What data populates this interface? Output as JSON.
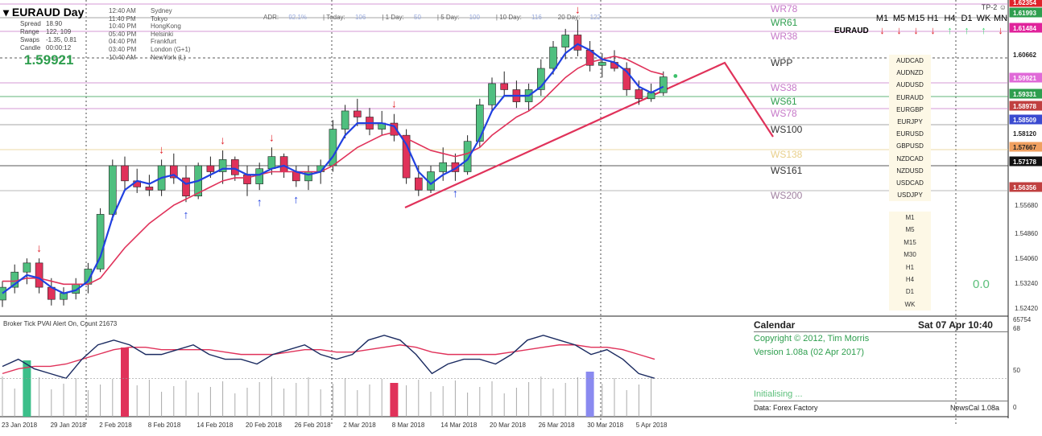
{
  "header": {
    "symbol_tf": "EURAUD  Day",
    "menu_marker": "▾",
    "info": [
      {
        "label": "Spread",
        "value": "18.90"
      },
      {
        "label": "Range",
        "value": "122, 109"
      },
      {
        "label": "Swaps",
        "value": "-1.35, 0.81"
      },
      {
        "label": "Candle",
        "value": "00:00:12"
      }
    ],
    "price": "1.59921",
    "clocks": [
      {
        "time": "12:40 AM",
        "city": "Sydney"
      },
      {
        "time": "11:40 PM",
        "city": "Tokyo"
      },
      {
        "time": "10:40 PM",
        "city": "HongKong"
      },
      {
        "time": "05:40 PM",
        "city": "Helsinki"
      },
      {
        "time": "04:40 PM",
        "city": "Frankfurt"
      },
      {
        "time": "03:40 PM",
        "city": "London  (G+1)"
      },
      {
        "time": "10:40 AM",
        "city": "NewYork  (L)"
      }
    ],
    "adr": [
      {
        "label": "ADR:",
        "value": "92.1%"
      },
      {
        "label": "| Today:",
        "value": "106"
      },
      {
        "label": "| 1 Day:",
        "value": "50"
      },
      {
        "label": "| 5 Day:",
        "value": "100"
      },
      {
        "label": "| 10 Day:",
        "value": "116"
      },
      {
        "label": "20 Day:",
        "value": "122"
      }
    ],
    "tp": "TP-2 ☺"
  },
  "timeframe_header": [
    "M1",
    "M5",
    "M15",
    "H1",
    "H4",
    "D1",
    "WK",
    "MN"
  ],
  "euraud_label": "EURAUD",
  "direction_arrows": [
    {
      "dir": "down",
      "color": "#e0232b"
    },
    {
      "dir": "down",
      "color": "#e0232b"
    },
    {
      "dir": "down",
      "color": "#e0232b"
    },
    {
      "dir": "down",
      "color": "#e0232b"
    },
    {
      "dir": "up",
      "color": "#4cd67a"
    },
    {
      "dir": "up",
      "color": "#4cd67a"
    },
    {
      "dir": "up",
      "color": "#4cd67a"
    },
    {
      "dir": "down",
      "color": "#e0232b"
    }
  ],
  "pairs": [
    "AUDCAD",
    "AUDNZD",
    "AUDUSD",
    "EURAUD",
    "EURGBP",
    "EURJPY",
    "EURUSD",
    "GBPUSD",
    "NZDCAD",
    "NZDUSD",
    "USDCAD",
    "USDJPY"
  ],
  "timeframes": [
    "M1",
    "M5",
    "M15",
    "M30",
    "H1",
    "H4",
    "D1",
    "WK"
  ],
  "zero_value": "0.0",
  "pivot_labels": [
    {
      "text": "WR78",
      "color": "#c678c8"
    },
    {
      "text": "WR61",
      "color": "#2e9e4e"
    },
    {
      "text": "WR38",
      "color": "#c678c8"
    },
    {
      "text": "WPP",
      "color": "#333333"
    },
    {
      "text": "WS38",
      "color": "#c678c8"
    },
    {
      "text": "WS61",
      "color": "#2e9e4e"
    },
    {
      "text": "WS78",
      "color": "#c678c8"
    },
    {
      "text": "WS100",
      "color": "#333333"
    },
    {
      "text": "WS138",
      "color": "#e8cf8a"
    },
    {
      "text": "WS161",
      "color": "#333333"
    },
    {
      "text": "WS200",
      "color": "#a080a0"
    }
  ],
  "price_axis": [
    "1.55680",
    "1.54860",
    "1.54060",
    "1.53240",
    "1.52420"
  ],
  "price_tags": [
    {
      "text": "1.62354",
      "color": "#e0232b"
    },
    {
      "text": "1.61993",
      "color": "#2e9e4e"
    },
    {
      "text": "1.61484",
      "color": "#e0239b"
    },
    {
      "text": "1.60662",
      "color": "#ffffff"
    },
    {
      "text": "1.59921",
      "color": "#e06ad8"
    },
    {
      "text": "1.59331",
      "color": "#2e9e4e"
    },
    {
      "text": "1.58978",
      "color": "#c04040"
    },
    {
      "text": "1.58509",
      "color": "#3a4ad0"
    },
    {
      "text": "1.58120",
      "color": "#ffffff"
    },
    {
      "text": "1.57667",
      "color": "#f0a060"
    },
    {
      "text": "1.57178",
      "color": "#111111"
    },
    {
      "text": "1.56356",
      "color": "#c04040"
    }
  ],
  "date_labels": [
    "23 Jan 2018",
    "29 Jan 2018",
    "2 Feb 2018",
    "8 Feb 2018",
    "14 Feb 2018",
    "20 Feb 2018",
    "26 Feb 2018",
    "2 Mar 2018",
    "8 Mar 2018",
    "14 Mar 2018",
    "20 Mar 2018",
    "26 Mar 2018",
    "30 Mar 2018",
    "5 Apr 2018"
  ],
  "indicator": {
    "title": "Broker Tick PVAI    Alert On,   Count  21673",
    "scale_top": "65754",
    "scale_68": "68",
    "scale_50": "50",
    "scale_bottom": "0"
  },
  "calendar": {
    "title": "Calendar",
    "date": "Sat 07 Apr 10:40",
    "copyright": "Copyright © 2012, Tim Morris",
    "version": "Version 1.08a (02 Apr 2017)",
    "status": "Initialising ...",
    "data_source": "Data: Forex Factory",
    "name": "NewsCal 1.08a"
  },
  "colors": {
    "bull": "#4fbf7f",
    "bear": "#e0325a",
    "ma_fast": "#2040e0",
    "ma_slow": "#e0325a",
    "trendline": "#e0325a"
  },
  "chart_data": {
    "type": "candlestick",
    "symbol": "EURAUD",
    "timeframe": "Day",
    "ylim": [
      1.5205,
      1.6245
    ],
    "candles": [
      [
        1.5258,
        1.532,
        1.5235,
        1.53
      ],
      [
        1.53,
        1.5375,
        1.528,
        1.535
      ],
      [
        1.535,
        1.5395,
        1.531,
        1.538
      ],
      [
        1.538,
        1.5395,
        1.528,
        1.53
      ],
      [
        1.53,
        1.533,
        1.524,
        1.526
      ],
      [
        1.526,
        1.53,
        1.524,
        1.528
      ],
      [
        1.528,
        1.533,
        1.526,
        1.531
      ],
      [
        1.531,
        1.538,
        1.528,
        1.536
      ],
      [
        1.536,
        1.556,
        1.535,
        1.554
      ],
      [
        1.554,
        1.572,
        1.552,
        1.57
      ],
      [
        1.57,
        1.573,
        1.562,
        1.565
      ],
      [
        1.565,
        1.569,
        1.561,
        1.563
      ],
      [
        1.563,
        1.567,
        1.56,
        1.562
      ],
      [
        1.562,
        1.572,
        1.56,
        1.57
      ],
      [
        1.57,
        1.574,
        1.564,
        1.566
      ],
      [
        1.566,
        1.57,
        1.558,
        1.56
      ],
      [
        1.56,
        1.571,
        1.559,
        1.57
      ],
      [
        1.57,
        1.573,
        1.566,
        1.568
      ],
      [
        1.568,
        1.575,
        1.564,
        1.572
      ],
      [
        1.572,
        1.573,
        1.565,
        1.567
      ],
      [
        1.567,
        1.57,
        1.56,
        1.564
      ],
      [
        1.564,
        1.571,
        1.562,
        1.569
      ],
      [
        1.569,
        1.576,
        1.567,
        1.573
      ],
      [
        1.573,
        1.574,
        1.566,
        1.568
      ],
      [
        1.568,
        1.57,
        1.563,
        1.565
      ],
      [
        1.565,
        1.57,
        1.562,
        1.568
      ],
      [
        1.568,
        1.572,
        1.564,
        1.57
      ],
      [
        1.57,
        1.585,
        1.568,
        1.582
      ],
      [
        1.582,
        1.59,
        1.579,
        1.588
      ],
      [
        1.588,
        1.592,
        1.583,
        1.586
      ],
      [
        1.586,
        1.589,
        1.58,
        1.582
      ],
      [
        1.582,
        1.588,
        1.58,
        1.584
      ],
      [
        1.584,
        1.587,
        1.578,
        1.58
      ],
      [
        1.58,
        1.582,
        1.564,
        1.566
      ],
      [
        1.566,
        1.57,
        1.56,
        1.562
      ],
      [
        1.562,
        1.57,
        1.561,
        1.568
      ],
      [
        1.568,
        1.576,
        1.565,
        1.571
      ],
      [
        1.571,
        1.574,
        1.565,
        1.568
      ],
      [
        1.568,
        1.58,
        1.567,
        1.578
      ],
      [
        1.578,
        1.592,
        1.576,
        1.59
      ],
      [
        1.59,
        1.599,
        1.588,
        1.597
      ],
      [
        1.597,
        1.601,
        1.593,
        1.595
      ],
      [
        1.595,
        1.598,
        1.589,
        1.591
      ],
      [
        1.591,
        1.597,
        1.588,
        1.595
      ],
      [
        1.595,
        1.605,
        1.593,
        1.602
      ],
      [
        1.602,
        1.611,
        1.6,
        1.609
      ],
      [
        1.609,
        1.615,
        1.605,
        1.613
      ],
      [
        1.613,
        1.618,
        1.606,
        1.608
      ],
      [
        1.608,
        1.611,
        1.601,
        1.603
      ],
      [
        1.603,
        1.607,
        1.599,
        1.604
      ],
      [
        1.604,
        1.608,
        1.601,
        1.602
      ],
      [
        1.602,
        1.604,
        1.593,
        1.595
      ],
      [
        1.595,
        1.598,
        1.59,
        1.592
      ],
      [
        1.592,
        1.597,
        1.591,
        1.594
      ],
      [
        1.594,
        1.601,
        1.593,
        1.5992
      ]
    ],
    "ma_fast": [
      1.528,
      1.531,
      1.534,
      1.533,
      1.53,
      1.528,
      1.529,
      1.532,
      1.54,
      1.553,
      1.562,
      1.565,
      1.564,
      1.566,
      1.567,
      1.564,
      1.565,
      1.567,
      1.569,
      1.569,
      1.567,
      1.567,
      1.569,
      1.57,
      1.568,
      1.567,
      1.568,
      1.573,
      1.58,
      1.584,
      1.584,
      1.584,
      1.583,
      1.577,
      1.568,
      1.564,
      1.567,
      1.569,
      1.572,
      1.579,
      1.588,
      1.593,
      1.593,
      1.593,
      1.596,
      1.601,
      1.607,
      1.61,
      1.608,
      1.605,
      1.604,
      1.601,
      1.596,
      1.594,
      1.596
    ],
    "ma_slow": [
      1.532,
      1.532,
      1.533,
      1.533,
      1.532,
      1.531,
      1.531,
      1.531,
      1.533,
      1.538,
      1.543,
      1.547,
      1.551,
      1.554,
      1.557,
      1.559,
      1.561,
      1.563,
      1.565,
      1.566,
      1.566,
      1.567,
      1.568,
      1.568,
      1.568,
      1.568,
      1.568,
      1.57,
      1.573,
      1.576,
      1.578,
      1.58,
      1.581,
      1.579,
      1.577,
      1.575,
      1.574,
      1.573,
      1.574,
      1.576,
      1.58,
      1.583,
      1.586,
      1.588,
      1.591,
      1.595,
      1.599,
      1.602,
      1.604,
      1.605,
      1.606,
      1.605,
      1.603,
      1.601,
      1.6
    ],
    "indicator_line1": [
      55,
      58,
      54,
      52,
      50,
      58,
      64,
      66,
      64,
      60,
      60,
      62,
      64,
      60,
      58,
      58,
      56,
      60,
      62,
      64,
      60,
      58,
      60,
      66,
      68,
      66,
      60,
      52,
      56,
      58,
      58,
      56,
      60,
      66,
      68,
      66,
      64,
      60,
      62,
      58,
      52,
      50
    ],
    "indicator_line2": [
      52,
      54,
      55,
      55,
      56,
      58,
      60,
      62,
      63,
      63,
      62,
      62,
      62,
      62,
      61,
      60,
      60,
      60,
      61,
      62,
      62,
      61,
      61,
      62,
      63,
      64,
      63,
      61,
      60,
      60,
      60,
      60,
      61,
      62,
      63,
      64,
      64,
      63,
      63,
      62,
      60,
      58
    ]
  }
}
